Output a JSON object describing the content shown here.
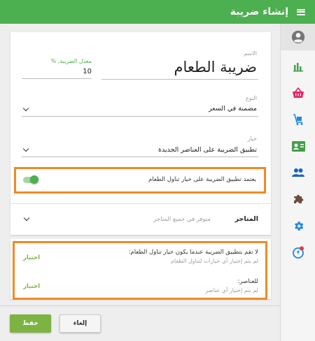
{
  "header": {
    "title": "إنشاء ضريبة"
  },
  "form": {
    "name_label": "الاسم",
    "name_value": "ضريبة الطعام",
    "rate_label": "معدل الضريبة, %",
    "rate_value": "10",
    "type_label": "النوع",
    "type_value": "مضمنة في السعر",
    "option_label": "خيار",
    "option_value": "تطبيق الضريبة على العناصر الجديدة",
    "dining_toggle_label": "يعتمد تطبيق الضريبة على خيار تناول الطعام",
    "dining_toggle_on": true,
    "stores_label": "المتاجر",
    "stores_value": "متوفر في جميع المتاجر"
  },
  "exceptions": {
    "dining_title": "لا تقم بتطبيق الضريبة عندما يكون خيار تناول الطعام:",
    "dining_sub": "لم يتم إختيار أي خيارات لتناول الطعام",
    "dining_select": "اختيار",
    "items_title": "للعناصر:",
    "items_sub": "لم يتم إختيار أي عناصر",
    "items_select": "اختيار"
  },
  "actions": {
    "save_label": "حفظ",
    "cancel_label": "إلغاء"
  },
  "sidebar": {
    "items": [
      {
        "icon": "account-circle-icon",
        "color": "#757575"
      },
      {
        "icon": "bar-chart-icon",
        "color": "#43a047"
      },
      {
        "icon": "basket-icon",
        "color": "#e91e63"
      },
      {
        "icon": "cart-box-icon",
        "color": "#1e88e5"
      },
      {
        "icon": "id-card-icon",
        "color": "#43a047"
      },
      {
        "icon": "people-icon",
        "color": "#1565c0"
      },
      {
        "icon": "puzzle-icon",
        "color": "#6d4c41"
      },
      {
        "icon": "gear-icon",
        "color": "#1e88e5"
      },
      {
        "icon": "help-icon",
        "color": "#1e88e5"
      }
    ]
  },
  "colors": {
    "primary": "#4caf50",
    "accent": "#7cb342",
    "highlight": "#f08a24"
  }
}
